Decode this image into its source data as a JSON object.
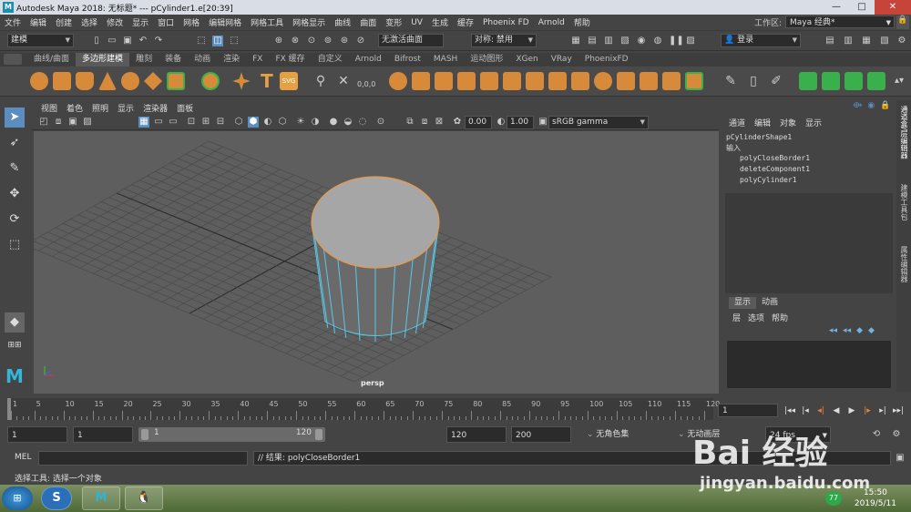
{
  "window": {
    "title": "Autodesk Maya 2018: 无标题*   ---   pCylinder1.e[20:39]",
    "logo": "M"
  },
  "menu": [
    "文件",
    "编辑",
    "创建",
    "选择",
    "修改",
    "显示",
    "窗口",
    "网格",
    "编辑网格",
    "网格工具",
    "网格显示",
    "曲线",
    "曲面",
    "变形",
    "UV",
    "生成",
    "缓存",
    "Phoenix FD",
    "Arnold",
    "帮助"
  ],
  "workspace": {
    "label": "工作区:",
    "value": "Maya 经典*"
  },
  "status": {
    "mode": "建模",
    "live": "无激活曲面",
    "symmetry": "对称: 禁用",
    "login": "登录"
  },
  "shelf_tabs": [
    "曲线/曲面",
    "多边形建模",
    "雕刻",
    "装备",
    "动画",
    "渲染",
    "FX",
    "FX 缓存",
    "自定义",
    "Arnold",
    "Bifrost",
    "MASH",
    "运动图形",
    "XGen",
    "VRay",
    "PhoenixFD"
  ],
  "shelf_active": 1,
  "viewport": {
    "menu": [
      "视图",
      "着色",
      "照明",
      "显示",
      "渲染器",
      "面板"
    ],
    "exposure": "0.00",
    "gamma": "1.00",
    "colorspace": "sRGB gamma",
    "camera": "persp"
  },
  "channel_box": {
    "menu": [
      "通道",
      "编辑",
      "对象",
      "显示"
    ],
    "shape": "pCylinderShape1",
    "inputs_label": "输入",
    "inputs": [
      "polyCloseBorder1",
      "deleteComponent1",
      "polyCylinder1"
    ]
  },
  "layer_editor": {
    "tabs": [
      "显示",
      "动画"
    ],
    "menu": [
      "层",
      "选项",
      "帮助"
    ]
  },
  "side_tabs": [
    "通道盒/层编辑器",
    "建模工具包",
    "属性编辑器"
  ],
  "timeline": {
    "ticks": [
      "1",
      "5",
      "10",
      "15",
      "20",
      "25",
      "30",
      "35",
      "40",
      "45",
      "50",
      "55",
      "60",
      "65",
      "70",
      "75",
      "80",
      "85",
      "90",
      "95",
      "100",
      "105",
      "110",
      "115",
      "120"
    ],
    "current": "1"
  },
  "range": {
    "start": "1",
    "inner_start": "1",
    "slider_start": "1",
    "slider_end": "120",
    "end": "120",
    "max": "200",
    "char_set": "无角色集",
    "anim_layer": "无动画层",
    "fps": "24 fps"
  },
  "mel": {
    "label": "MEL",
    "result": "// 结果: polyCloseBorder1"
  },
  "help": "选择工具: 选择一个对象",
  "taskbar": {
    "time": "15:50",
    "date": "2019/5/11",
    "badge": "77"
  },
  "watermark": {
    "brand": "Bai 经验",
    "url": "jingyan.baidu.com"
  },
  "colors": {
    "accent": "#5b8dbf",
    "cylinder_edge": "#58c8e8",
    "selection": "#e89a4a"
  }
}
